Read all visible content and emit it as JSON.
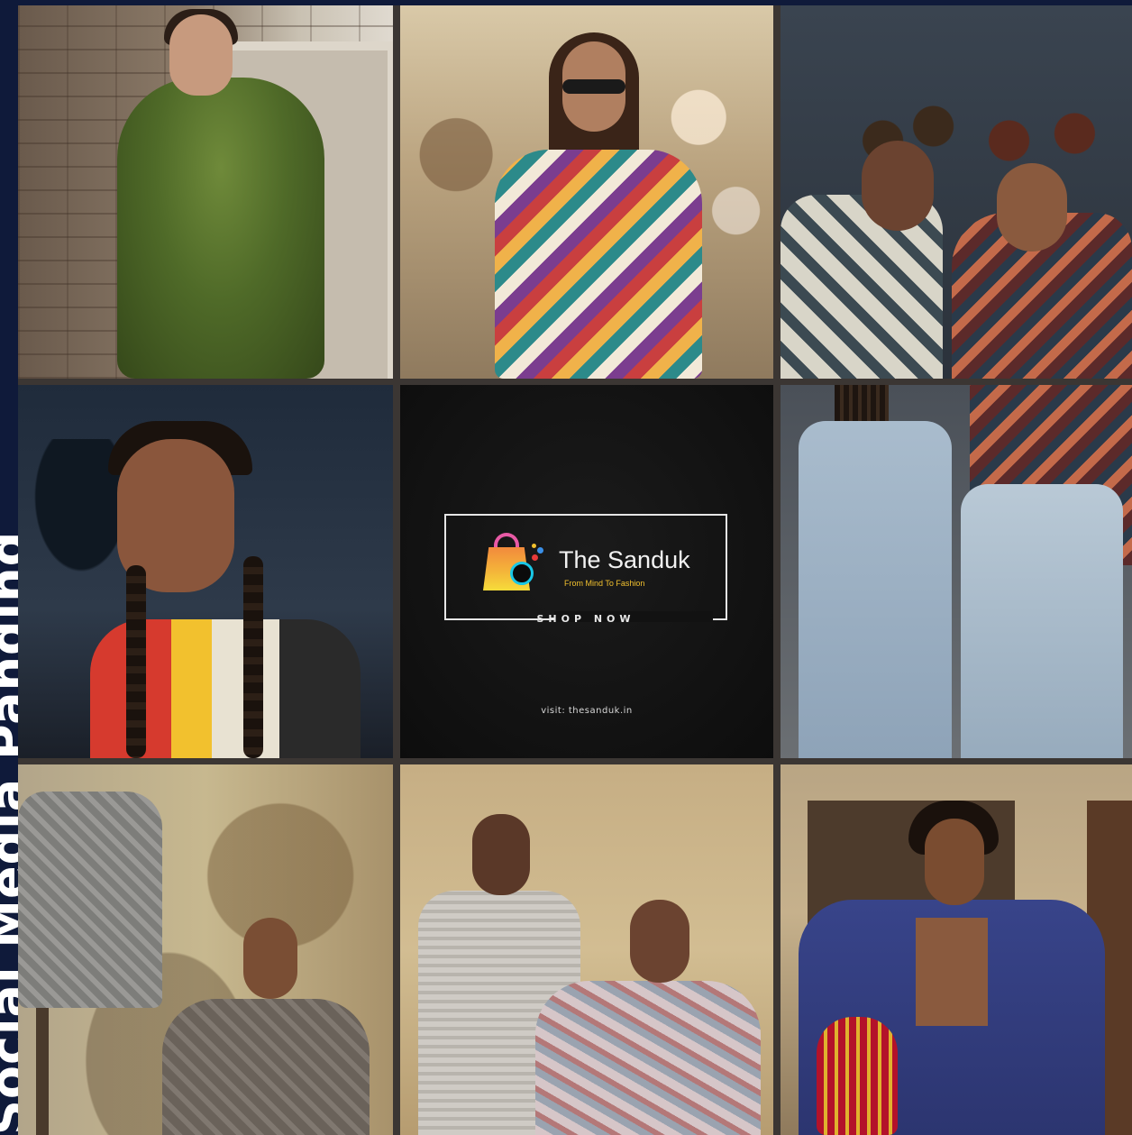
{
  "side_banner": {
    "text": "Social Media Panding"
  },
  "promo_card": {
    "brand_name": "The Sanduk",
    "tagline": "From Mind To Fashion",
    "cta": "SHOP NOW",
    "website": "visit: thesanduk.in"
  },
  "colors": {
    "banner_bg": "#0f1a3a",
    "card_bg": "#111111",
    "grid_gap": "#3b3633",
    "bag_gradient": [
      "#f28a3c",
      "#f6dc3a"
    ],
    "bag_handle": "#e85aa5",
    "bag_ring": "#19c7e6",
    "tagline": "#f2c12e"
  },
  "tiles": [
    {
      "id": 1,
      "kind": "photo"
    },
    {
      "id": 2,
      "kind": "photo"
    },
    {
      "id": 3,
      "kind": "photo"
    },
    {
      "id": 4,
      "kind": "photo"
    },
    {
      "id": 5,
      "kind": "promo-card"
    },
    {
      "id": 6,
      "kind": "photo"
    },
    {
      "id": 7,
      "kind": "photo"
    },
    {
      "id": 8,
      "kind": "photo"
    },
    {
      "id": 9,
      "kind": "photo"
    }
  ]
}
